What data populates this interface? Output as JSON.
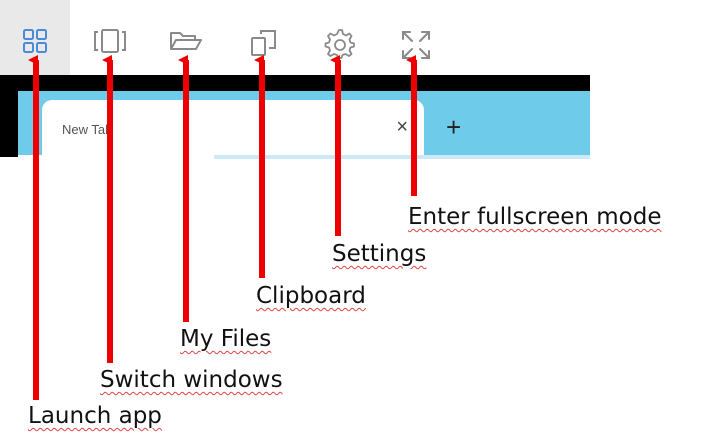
{
  "toolbar": {
    "items": [
      {
        "name": "launch-app",
        "icon": "grid-apps-icon"
      },
      {
        "name": "switch-windows",
        "icon": "windows-switch-icon"
      },
      {
        "name": "my-files",
        "icon": "folder-open-icon"
      },
      {
        "name": "clipboard",
        "icon": "clipboard-copy-icon"
      },
      {
        "name": "settings",
        "icon": "gear-icon"
      },
      {
        "name": "fullscreen",
        "icon": "expand-arrows-icon"
      }
    ]
  },
  "browser": {
    "tab_title": "New Tab",
    "close_glyph": "×",
    "new_tab_glyph": "+"
  },
  "callouts": {
    "launch_app": "Launch app",
    "switch_windows": "Switch windows",
    "my_files": "My Files",
    "clipboard": "Clipboard",
    "settings": "Settings",
    "fullscreen": "Enter fullscreen mode"
  },
  "colors": {
    "arrow": "#ee0000",
    "tabstrip": "#6ecbe9",
    "icon_blue": "#4a8ad8",
    "icon_gray": "#8a8a8a"
  }
}
